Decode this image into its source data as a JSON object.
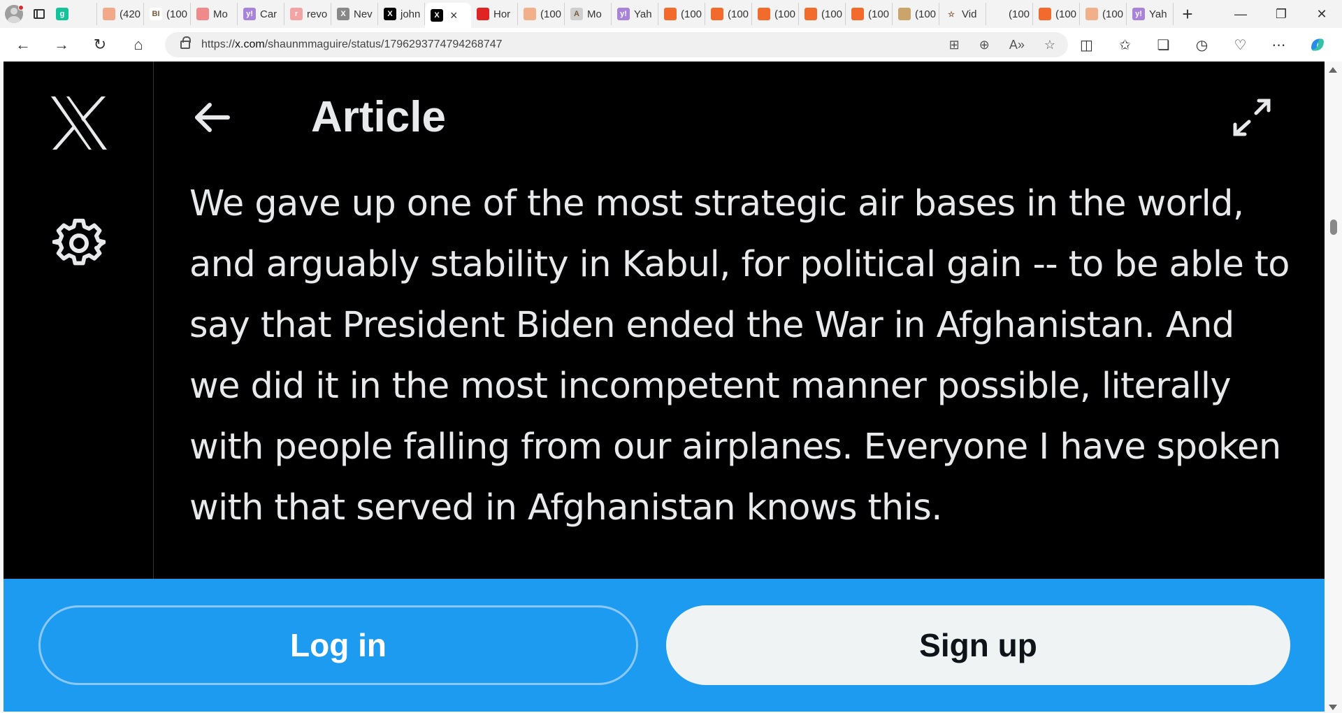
{
  "browser": {
    "tabs": [
      {
        "label": "",
        "icon": "grammarly-icon",
        "color": "#15c39a",
        "glyph": "g"
      },
      {
        "label": "(420",
        "icon": "bookmark-favicon-icon",
        "color": "#f2a98a",
        "glyph": ""
      },
      {
        "label": "(100",
        "icon": "bi-favicon-icon",
        "color": "#ffffff",
        "glyph": "BI"
      },
      {
        "label": "Mo",
        "icon": "youtube-icon",
        "color": "#f08a8a",
        "glyph": ""
      },
      {
        "label": "Car",
        "icon": "yahoo-icon",
        "color": "#a784d9",
        "glyph": "y!"
      },
      {
        "label": "revo",
        "icon": "r-favicon-icon",
        "color": "#f2a3a3",
        "glyph": "r"
      },
      {
        "label": "Nev",
        "icon": "x-favicon-icon",
        "color": "#888888",
        "glyph": "X"
      },
      {
        "label": "john",
        "icon": "x-favicon-icon",
        "color": "#000000",
        "glyph": "X"
      },
      {
        "label": "",
        "icon": "x-favicon-icon",
        "color": "#000000",
        "glyph": "X"
      },
      {
        "label": "Hor",
        "icon": "red-favicon-icon",
        "color": "#e02424",
        "glyph": ""
      },
      {
        "label": "(100",
        "icon": "bookmark-favicon-icon",
        "color": "#f2b08a",
        "glyph": ""
      },
      {
        "label": "Mo",
        "icon": "ai-favicon-icon",
        "color": "#cfcfcf",
        "glyph": "A"
      },
      {
        "label": "Yah",
        "icon": "yahoo-icon",
        "color": "#a784d9",
        "glyph": "y!"
      },
      {
        "label": "(100",
        "icon": "bookmark-favicon-icon",
        "color": "#f26a2c",
        "glyph": ""
      },
      {
        "label": "(100",
        "icon": "bookmark-favicon-icon",
        "color": "#f26a2c",
        "glyph": ""
      },
      {
        "label": "(100",
        "icon": "stack-favicon-icon",
        "color": "#f26a2c",
        "glyph": ""
      },
      {
        "label": "(100",
        "icon": "bookmark-favicon-icon",
        "color": "#f26a2c",
        "glyph": ""
      },
      {
        "label": "(100",
        "icon": "bookmark-favicon-icon",
        "color": "#f26a2c",
        "glyph": ""
      },
      {
        "label": "(100",
        "icon": "avatar-favicon-icon",
        "color": "#caa46a",
        "glyph": ""
      },
      {
        "label": "Vid",
        "icon": "star-favicon-icon",
        "color": "#f3f3f3",
        "glyph": "☆"
      },
      {
        "label": "(100",
        "icon": "page-favicon-icon",
        "color": "#f3f3f3",
        "glyph": ""
      },
      {
        "label": "(100",
        "icon": "bookmark-favicon-icon",
        "color": "#f26a2c",
        "glyph": ""
      },
      {
        "label": "(100",
        "icon": "bookmark-favicon-icon",
        "color": "#f2b08a",
        "glyph": ""
      },
      {
        "label": "Yah",
        "icon": "yahoo-icon",
        "color": "#a784d9",
        "glyph": "y!"
      }
    ],
    "url_prefix": "https://",
    "url_host": "x.com",
    "url_path": "/shaunmmaguire/status/1796293774794268747"
  },
  "article": {
    "title": "Article",
    "body": "We gave up one of the most strategic air bases in the world, and arguably stability in Kabul, for political gain -- to be able to say that President Biden ended the War in Afghanistan. And we did it in the most incompetent manner possible, literally with people falling from our airplanes. Everyone I have spoken with that served in Afghanistan knows this."
  },
  "auth": {
    "login_label": "Log in",
    "signup_label": "Sign up"
  },
  "colors": {
    "x_blue": "#1d9bf0",
    "page_bg": "#000000",
    "text": "#e7e9ea"
  }
}
